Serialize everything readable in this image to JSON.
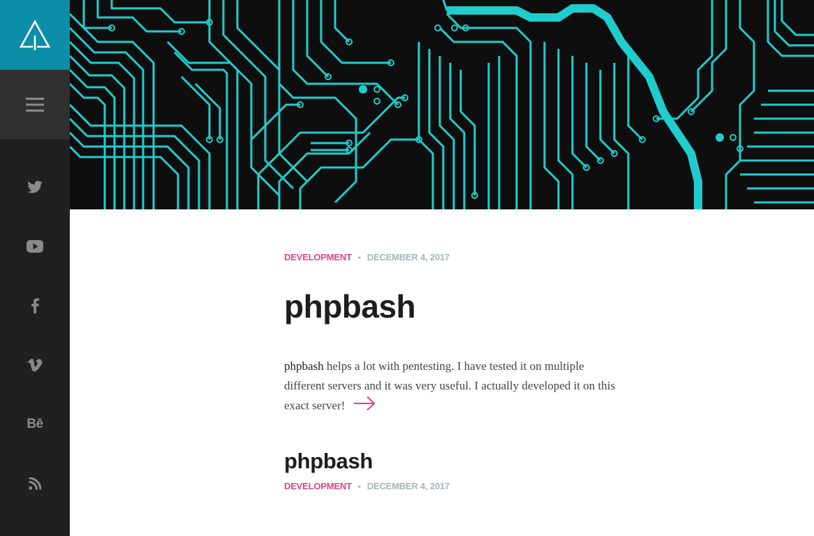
{
  "colors": {
    "sidebar_bg": "#202020",
    "logo_bg": "#0c8ea8",
    "menu_bg": "#303030",
    "icon_color": "#8a8a8a",
    "hero_bg": "#0e0e0e",
    "circuit": "#1fcdcd",
    "category_accent": "#d9468a",
    "date_color": "#a6b4bb",
    "title_color": "#1d1d1d"
  },
  "sidebar": {
    "logo_icon": "triangle-tree-logo",
    "menu_icon": "hamburger-icon",
    "social": [
      {
        "name": "twitter",
        "icon": "twitter-icon"
      },
      {
        "name": "youtube",
        "icon": "youtube-icon"
      },
      {
        "name": "facebook",
        "icon": "facebook-icon"
      },
      {
        "name": "vimeo",
        "icon": "vimeo-icon"
      },
      {
        "name": "behance",
        "icon": "behance-icon",
        "glyph": "Bē"
      },
      {
        "name": "rss",
        "icon": "rss-icon"
      }
    ]
  },
  "hero": {
    "image": "circuit-board-banner"
  },
  "posts": [
    {
      "category": "Development",
      "separator": "•",
      "date": "December 4, 2017",
      "title": "phpbash",
      "excerpt_lead": "phpbash",
      "excerpt_rest": " helps a lot with pentesting. I have tested it on multiple different servers and it was very useful. I actually developed it on this exact server!",
      "read_more_icon": "arrow-right-icon"
    },
    {
      "title": "phpbash",
      "category": "Development",
      "separator": "•",
      "date": "December 4, 2017"
    }
  ]
}
